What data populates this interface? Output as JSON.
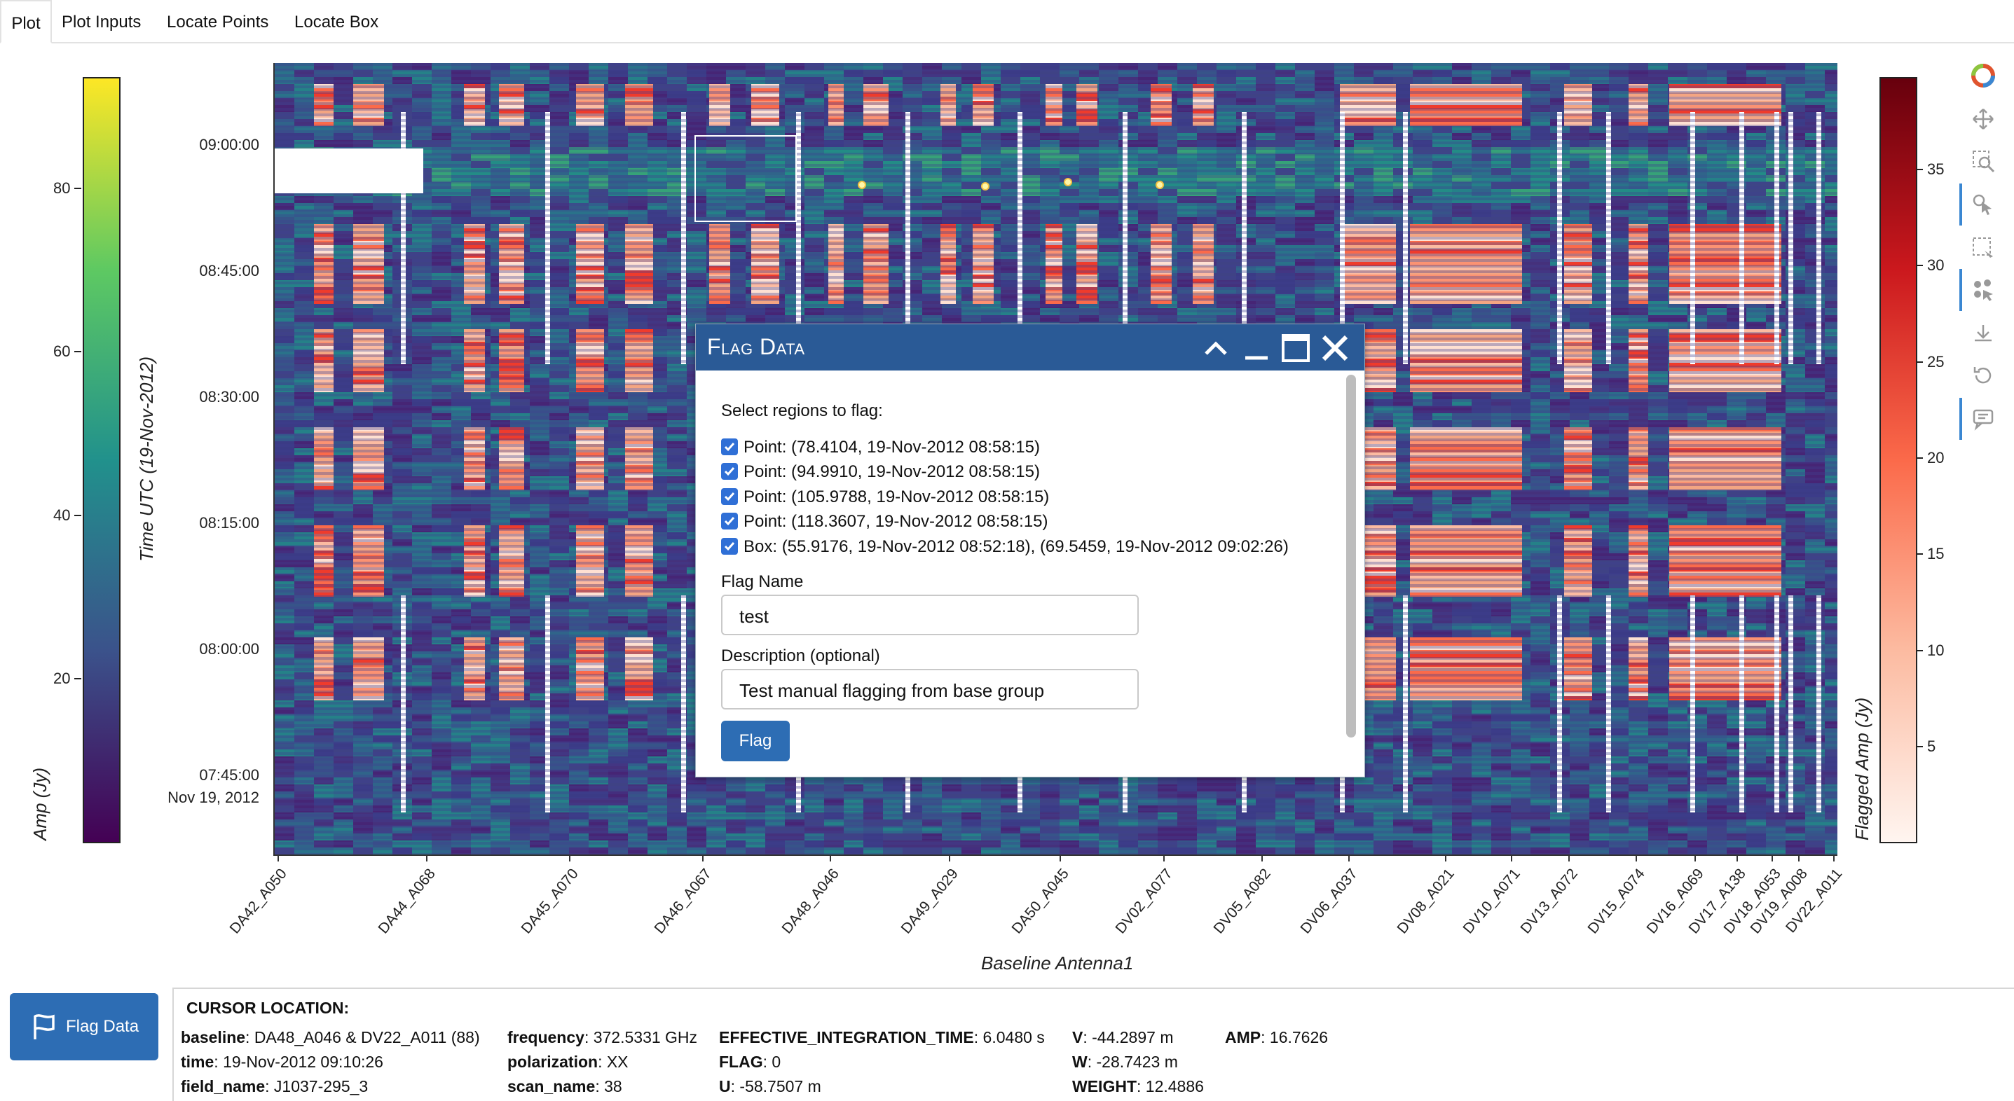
{
  "tabs": [
    {
      "label": "Plot",
      "active": true
    },
    {
      "label": "Plot Inputs"
    },
    {
      "label": "Locate Points"
    },
    {
      "label": "Locate Box"
    }
  ],
  "left_colorbar": {
    "label": "Amp (Jy)",
    "ticks": [
      "80",
      "60",
      "40",
      "20"
    ],
    "colors": [
      "#440154",
      "#3b528b",
      "#21918c",
      "#5ec962",
      "#fde725"
    ]
  },
  "right_colorbar": {
    "label": "Flagged Amp (Jy)",
    "ticks": [
      "35",
      "30",
      "25",
      "20",
      "15",
      "10",
      "5"
    ],
    "colors": [
      "#fff5f0",
      "#fcbba1",
      "#fb6a4a",
      "#cb181d",
      "#67000d"
    ]
  },
  "plot": {
    "ylabel": "Time UTC (19-Nov-2012)",
    "xlabel": "Baseline Antenna1",
    "yticks": [
      "09:00:00",
      "08:45:00",
      "08:30:00",
      "08:15:00",
      "08:00:00",
      "07:45:00"
    ],
    "ydate": "Nov 19, 2012",
    "xticks": [
      "DA42_A050",
      "DA44_A068",
      "DA45_A070",
      "DA46_A067",
      "DA48_A046",
      "DA49_A029",
      "DA50_A045",
      "DV02_A077",
      "DV05_A082",
      "DV06_A037",
      "DV08_A021",
      "DV10_A071",
      "DV13_A072",
      "DV15_A074",
      "DV16_A069",
      "DV17_A138",
      "DV18_A053",
      "DV19_A008",
      "DV22_A011"
    ]
  },
  "toolbar": [
    "bokeh-logo-icon",
    "pan-icon",
    "box-zoom-icon",
    "tap-select-icon",
    "box-select-icon",
    "point-draw-icon",
    "save-icon",
    "reset-icon",
    "hover-icon"
  ],
  "dialog": {
    "title": "Flag Data",
    "prompt": "Select regions to flag:",
    "regions": [
      "Point: (78.4104, 19-Nov-2012 08:58:15)",
      "Point: (94.9910, 19-Nov-2012 08:58:15)",
      "Point: (105.9788, 19-Nov-2012 08:58:15)",
      "Point: (118.3607, 19-Nov-2012 08:58:15)",
      "Box: (55.9176, 19-Nov-2012 08:52:18), (69.5459, 19-Nov-2012 09:02:26)"
    ],
    "flag_name_label": "Flag Name",
    "flag_name_value": "test",
    "description_label": "Description (optional)",
    "description_value": "Test manual flagging from base group",
    "flag_button": "Flag"
  },
  "flag_data_button": "Flag Data",
  "cursor": {
    "title": "CURSOR LOCATION",
    "col1": [
      {
        "k": "baseline",
        "v": "DA48_A046 & DV22_A011 (88)"
      },
      {
        "k": "time",
        "v": "19-Nov-2012 09:10:26"
      },
      {
        "k": "field_name",
        "v": "J1037-295_3"
      }
    ],
    "col2": [
      {
        "k": "frequency",
        "v": "372.5331 GHz"
      },
      {
        "k": "polarization",
        "v": "XX"
      },
      {
        "k": "scan_name",
        "v": "38"
      }
    ],
    "col3": [
      {
        "k": "EFFECTIVE_INTEGRATION_TIME",
        "v": "6.0480 s"
      },
      {
        "k": "FLAG",
        "v": "0"
      },
      {
        "k": "U",
        "v": "-58.7507 m"
      }
    ],
    "col4": [
      {
        "k": "V",
        "v": "-44.2897 m"
      },
      {
        "k": "W",
        "v": "-28.7423 m"
      },
      {
        "k": "WEIGHT",
        "v": "12.4886"
      }
    ],
    "col5": [
      {
        "k": "AMP",
        "v": "16.7626"
      }
    ]
  }
}
